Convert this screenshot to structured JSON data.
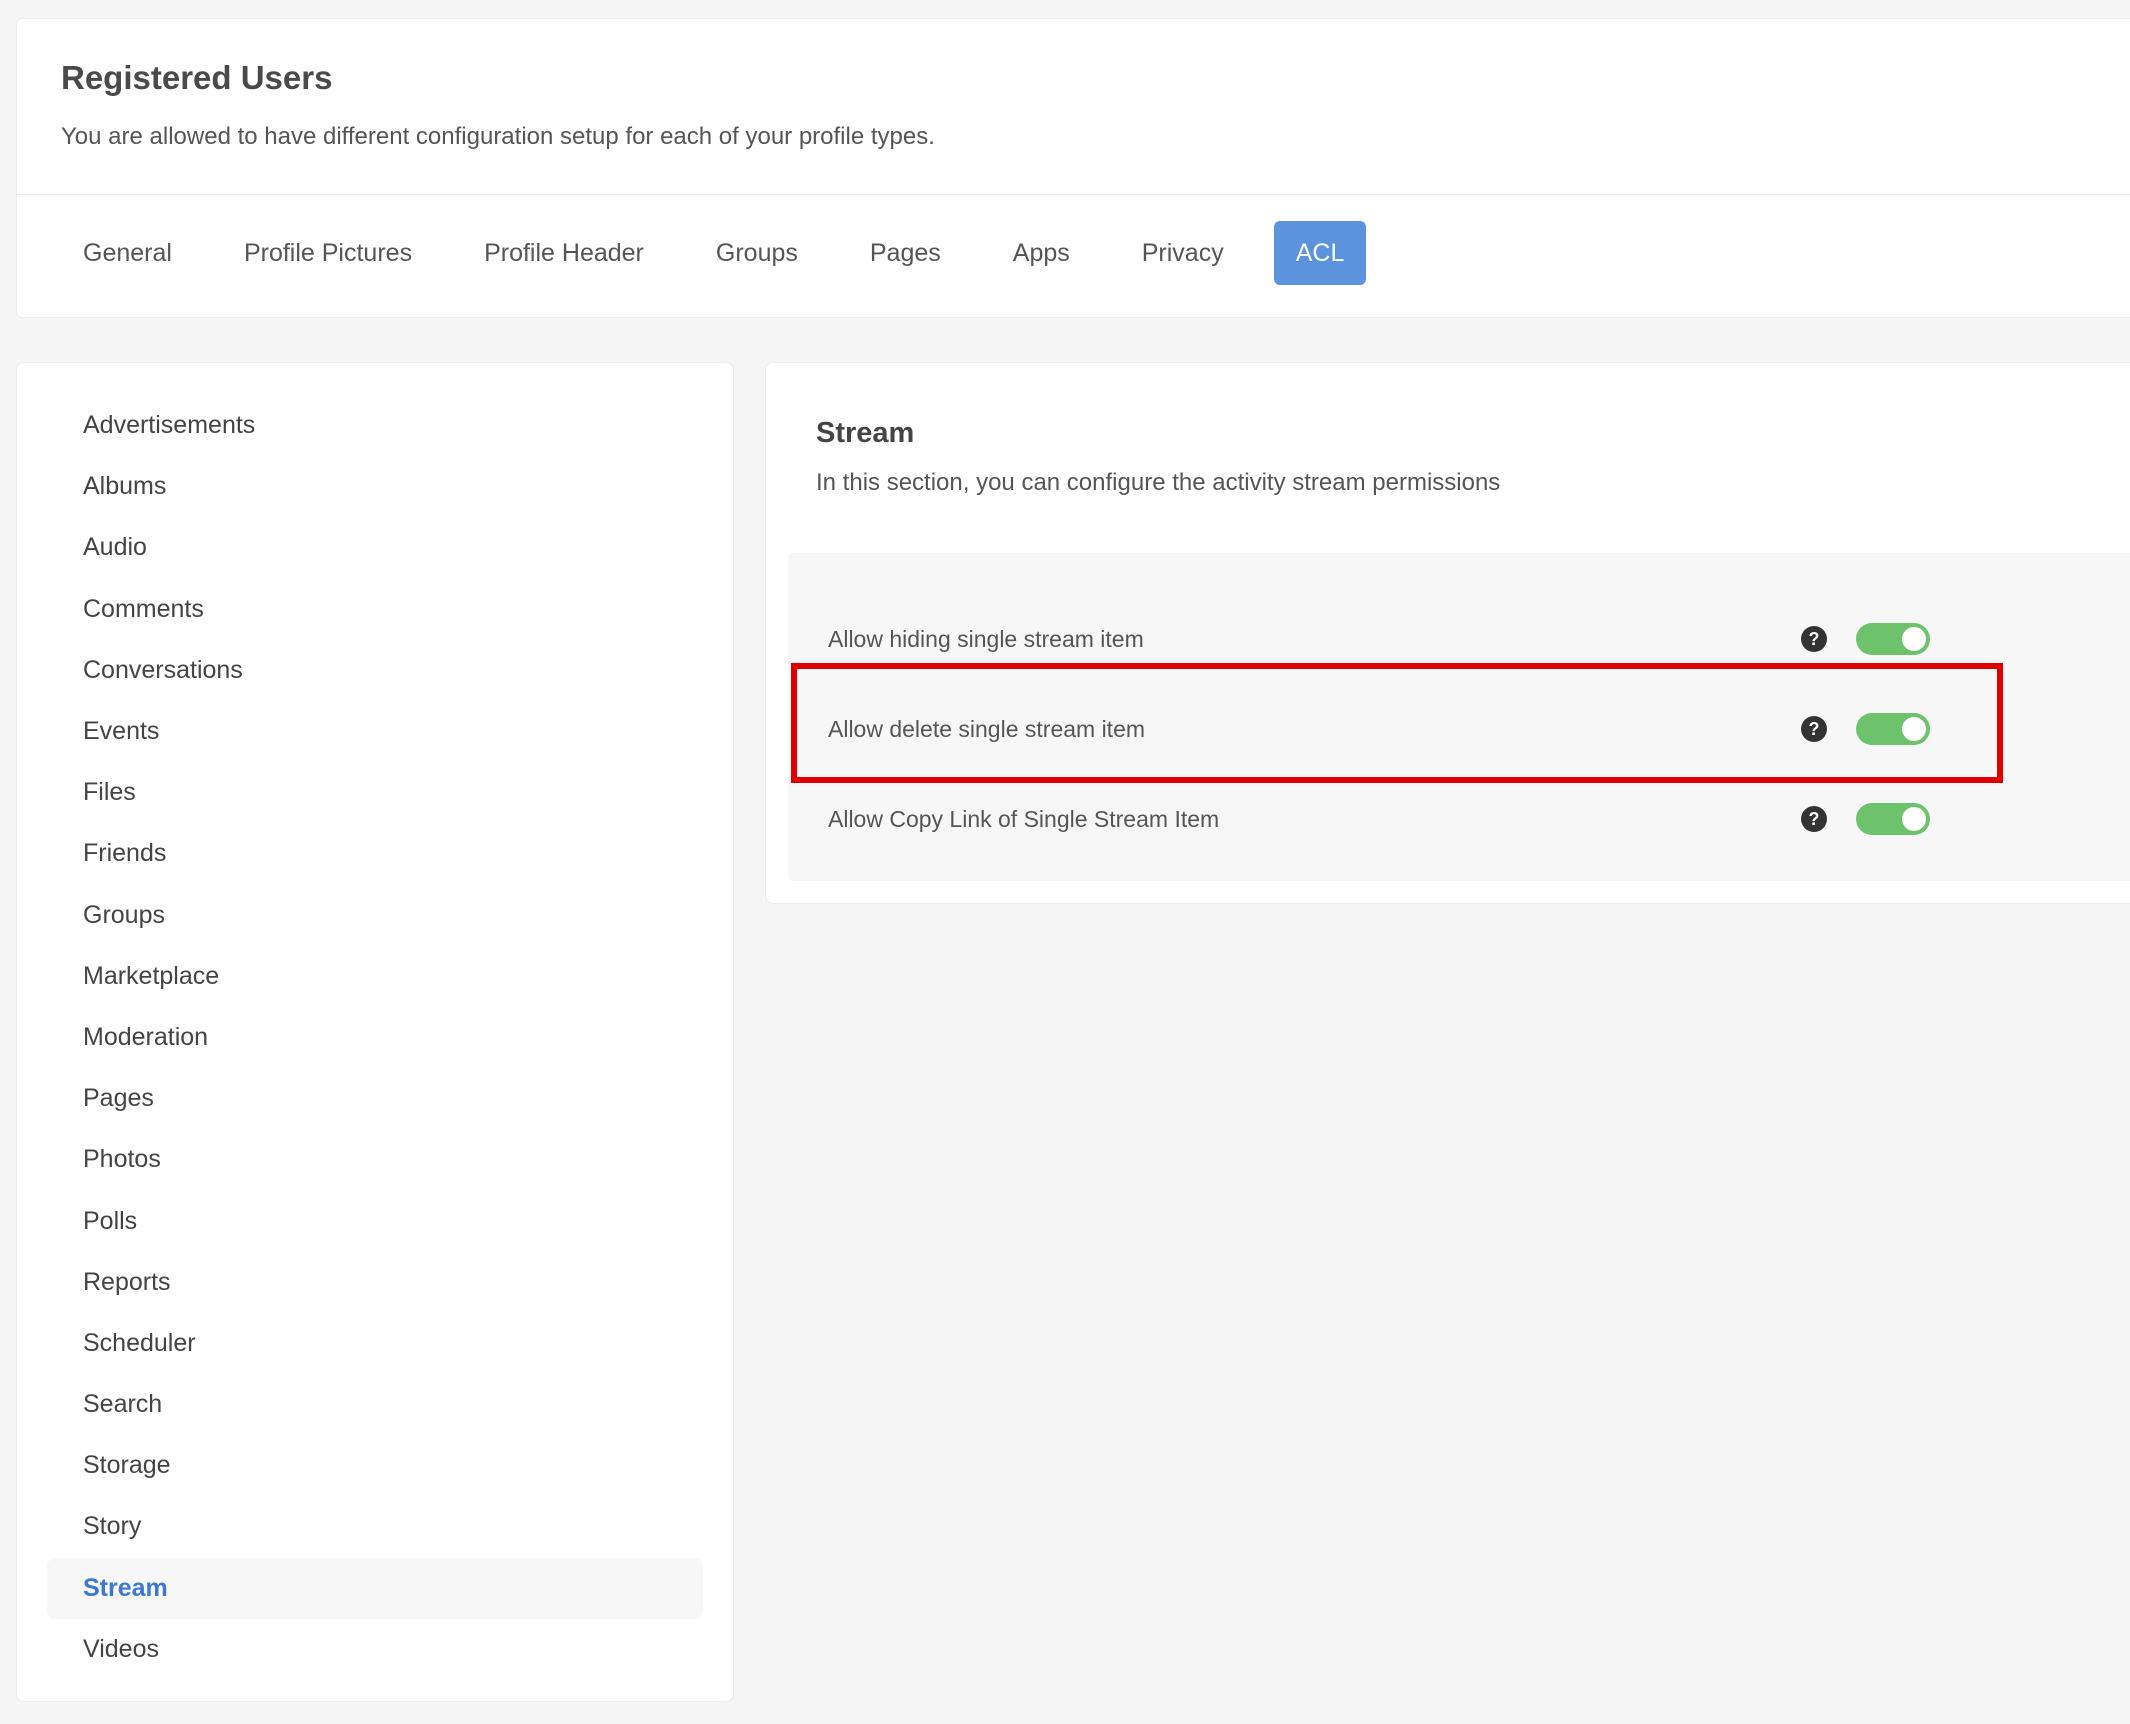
{
  "header": {
    "title": "Registered Users",
    "description": "You are allowed to have different configuration setup for each of your profile types."
  },
  "tabs": [
    {
      "label": "General"
    },
    {
      "label": "Profile Pictures"
    },
    {
      "label": "Profile Header"
    },
    {
      "label": "Groups"
    },
    {
      "label": "Pages"
    },
    {
      "label": "Apps"
    },
    {
      "label": "Privacy"
    },
    {
      "label": "ACL",
      "active": true
    }
  ],
  "sidebar": {
    "items": [
      {
        "label": "Advertisements"
      },
      {
        "label": "Albums"
      },
      {
        "label": "Audio"
      },
      {
        "label": "Comments"
      },
      {
        "label": "Conversations"
      },
      {
        "label": "Events"
      },
      {
        "label": "Files"
      },
      {
        "label": "Friends"
      },
      {
        "label": "Groups"
      },
      {
        "label": "Marketplace"
      },
      {
        "label": "Moderation"
      },
      {
        "label": "Pages"
      },
      {
        "label": "Photos"
      },
      {
        "label": "Polls"
      },
      {
        "label": "Reports"
      },
      {
        "label": "Scheduler"
      },
      {
        "label": "Search"
      },
      {
        "label": "Storage"
      },
      {
        "label": "Story"
      },
      {
        "label": "Stream",
        "active": true
      },
      {
        "label": "Videos"
      }
    ]
  },
  "section": {
    "title": "Stream",
    "description": "In this section, you can configure the activity stream permissions"
  },
  "settings": [
    {
      "label": "Allow hiding single stream item",
      "help_icon": "?",
      "enabled": true
    },
    {
      "label": "Allow delete single stream item",
      "help_icon": "?",
      "enabled": true
    },
    {
      "label": "Allow Copy Link of Single Stream Item",
      "help_icon": "?",
      "enabled": true
    }
  ],
  "colors": {
    "accent": "#5b93dd",
    "toggle_on": "#6cc36c",
    "active_sidebar_text": "#3d79d1",
    "highlight": "#e00000"
  }
}
